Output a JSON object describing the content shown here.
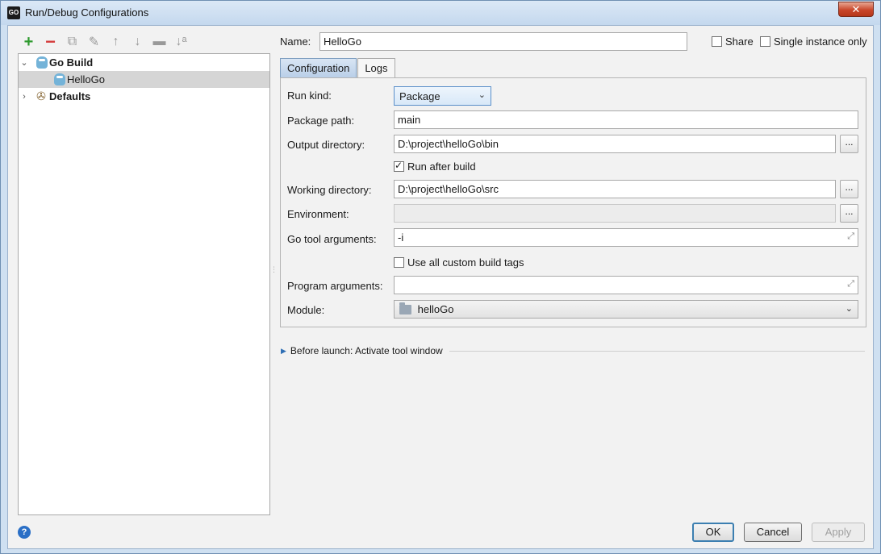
{
  "window": {
    "title": "Run/Debug Configurations",
    "app_icon_text": "GO"
  },
  "toolbar": {
    "add": "+",
    "remove": "−",
    "copy": "⧉",
    "edit_defaults": "✎",
    "move_up": "↑",
    "move_down": "↓",
    "folder": "▬",
    "sort": "↓ᵃ"
  },
  "tree": {
    "go_build": "Go Build",
    "hellogo": "HelloGo",
    "defaults": "Defaults"
  },
  "header": {
    "name_label": "Name:",
    "name_value": "HelloGo",
    "share_label": "Share",
    "single_instance_label": "Single instance only"
  },
  "tabs": {
    "configuration": "Configuration",
    "logs": "Logs"
  },
  "config": {
    "run_kind_label": "Run kind:",
    "run_kind_value": "Package",
    "package_path_label": "Package path:",
    "package_path_value": "main",
    "output_dir_label": "Output directory:",
    "output_dir_value": "D:\\project\\helloGo\\bin",
    "run_after_build_label": "Run after build",
    "working_dir_label": "Working directory:",
    "working_dir_value": "D:\\project\\helloGo\\src",
    "environment_label": "Environment:",
    "environment_value": "",
    "go_tool_args_label": "Go tool arguments:",
    "go_tool_args_value": "-i",
    "custom_build_tags_label": "Use all custom build tags",
    "program_args_label": "Program arguments:",
    "program_args_value": "",
    "module_label": "Module:",
    "module_value": "helloGo",
    "browse_label": "..."
  },
  "before_launch": {
    "label": "Before launch: Activate tool window"
  },
  "buttons": {
    "help": "?",
    "ok": "OK",
    "cancel": "Cancel",
    "apply": "Apply"
  },
  "colors": {
    "accent": "#3c7fb1",
    "add_green": "#2e9a2e",
    "remove_red": "#d43c3c",
    "tab_active": "#b9cfe8"
  },
  "icons": {
    "close": "close-icon",
    "gopher": "gopher-icon",
    "defaults": "wrench-icon",
    "expand": "expand-icon",
    "folder": "folder-icon"
  }
}
